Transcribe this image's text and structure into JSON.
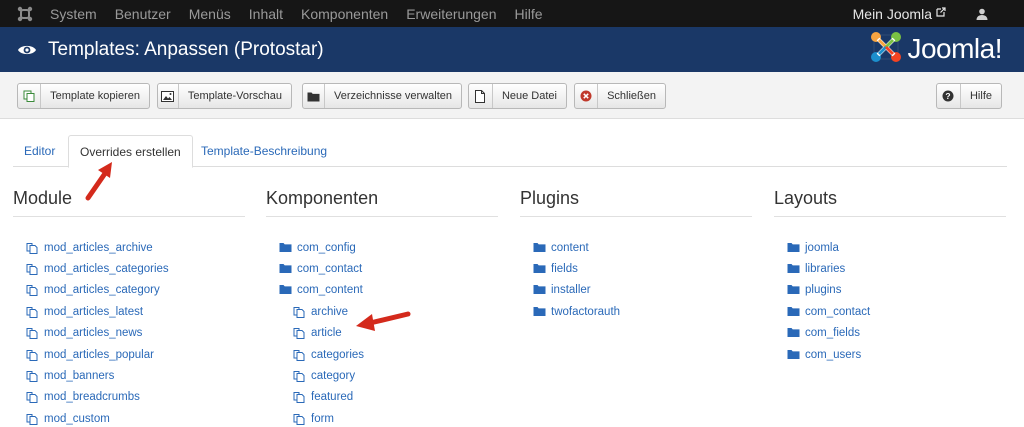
{
  "topbar": {
    "menu": [
      "System",
      "Benutzer",
      "Menüs",
      "Inhalt",
      "Komponenten",
      "Erweiterungen",
      "Hilfe"
    ],
    "site_link": "Mein Joomla"
  },
  "header": {
    "title": "Templates: Anpassen (Protostar)",
    "brand": "Joomla!"
  },
  "toolbar": {
    "copy": "Template kopieren",
    "preview": "Template-Vorschau",
    "folders": "Verzeichnisse verwalten",
    "new_file": "Neue Datei",
    "close": "Schließen",
    "help": "Hilfe"
  },
  "tabs": [
    "Editor",
    "Overrides erstellen",
    "Template-Beschreibung"
  ],
  "columns": {
    "module": {
      "title": "Module",
      "items": [
        "mod_articles_archive",
        "mod_articles_categories",
        "mod_articles_category",
        "mod_articles_latest",
        "mod_articles_news",
        "mod_articles_popular",
        "mod_banners",
        "mod_breadcrumbs",
        "mod_custom"
      ]
    },
    "components": {
      "title": "Komponenten",
      "items": [
        "com_config",
        "com_contact",
        "com_content"
      ],
      "sub_items": [
        "archive",
        "article",
        "categories",
        "category",
        "featured",
        "form"
      ]
    },
    "plugins": {
      "title": "Plugins",
      "items": [
        "content",
        "fields",
        "installer",
        "twofactorauth"
      ]
    },
    "layouts": {
      "title": "Layouts",
      "items": [
        "joomla",
        "libraries",
        "plugins",
        "com_contact",
        "com_fields",
        "com_users"
      ]
    }
  },
  "colors": {
    "topbar": "#161616",
    "header": "#1a3867",
    "link": "#2a69b8",
    "arrow": "#d42a1c"
  }
}
